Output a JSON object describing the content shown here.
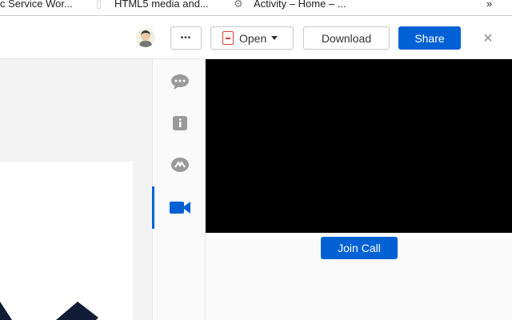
{
  "bookmarks": [
    {
      "label": "c Service Wor..."
    },
    {
      "label": "HTML5 media and..."
    },
    {
      "label": "Activity – Home – ..."
    }
  ],
  "bookmarks_overflow": "»",
  "toolbar": {
    "more_label": "•••",
    "open_label": "Open",
    "download_label": "Download",
    "share_label": "Share"
  },
  "sidebar": {
    "items": [
      {
        "icon": "comment-icon"
      },
      {
        "icon": "info-icon"
      },
      {
        "icon": "activity-icon"
      },
      {
        "icon": "video-icon",
        "active": true
      }
    ]
  },
  "call": {
    "join_label": "Join Call"
  },
  "colors": {
    "accent": "#0061d5",
    "video_bg": "#000000"
  }
}
